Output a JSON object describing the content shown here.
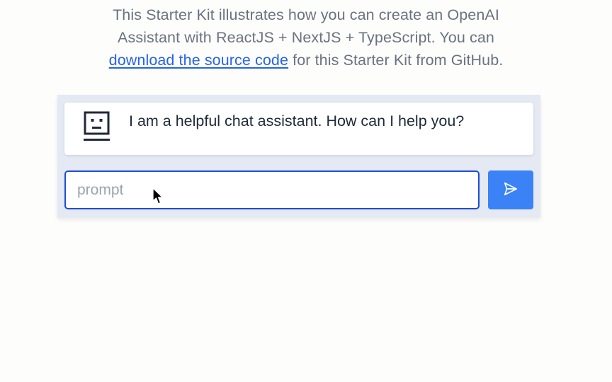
{
  "intro": {
    "line1": "This Starter Kit illustrates how you can create an OpenAI",
    "line2": "Assistant with ReactJS + NextJS + TypeScript. You can",
    "link_text": "download the source code",
    "line3_rest": " for this Starter Kit from GitHub."
  },
  "chat": {
    "messages": [
      {
        "role": "assistant",
        "avatar_icon": "robot-face-icon",
        "text": "I am a helpful chat assistant. How can I help you?"
      }
    ],
    "input": {
      "value": "",
      "placeholder": "prompt"
    },
    "send_button": {
      "icon": "paper-plane-icon"
    }
  },
  "colors": {
    "link": "#2563eb",
    "accent": "#3b82f6",
    "input_border": "#1d4ed8",
    "panel_bg": "#e4e9f3"
  }
}
